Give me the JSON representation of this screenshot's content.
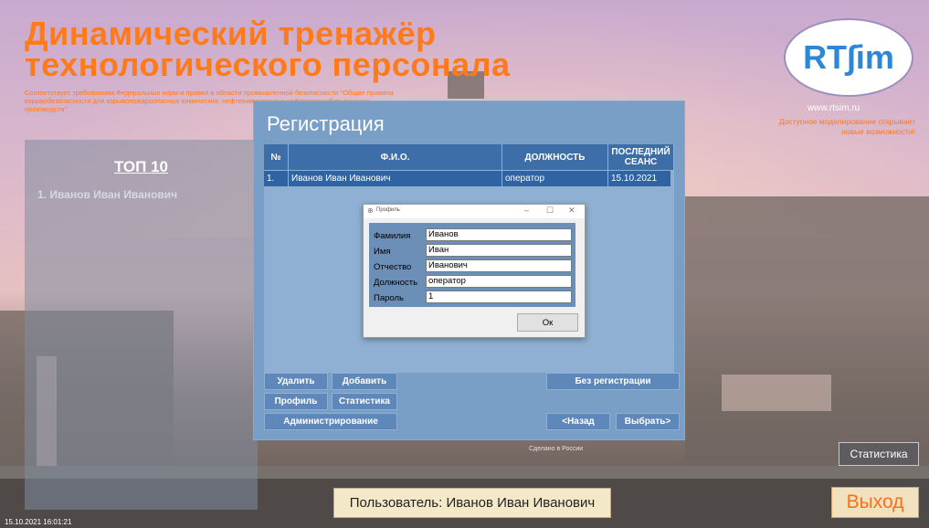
{
  "app": {
    "title_line1": "Динамический тренажёр",
    "title_line2": "технологического персонала",
    "subtitle": "Соответствует требованиям Федеральных норм и правил в области промышленной безопасности \"Общие правила взрывобезопасности для взрывопожароопасных химических, нефтехимических и нефтеперерабатывающих производств\"",
    "logo_text": "RT∫im",
    "logo_url": "www.rtsim.ru",
    "slogan": "Доступное моделирование открывает новые возможности!",
    "made_in": "Сделано в России"
  },
  "top10": {
    "title": "ТОП 10",
    "items": [
      "1. Иванов Иван Иванович"
    ]
  },
  "registration": {
    "title": "Регистрация",
    "columns": [
      "№",
      "Ф.И.О.",
      "ДОЛЖНОСТЬ",
      "ПОСЛЕДНИЙ СЕАНС"
    ],
    "rows": [
      {
        "num": "1.",
        "name": "Иванов Иван Иванович",
        "position": "оператор",
        "last_session": "15.10.2021"
      }
    ],
    "buttons": {
      "delete": "Удалить",
      "add": "Добавить",
      "profile": "Профиль",
      "statistics": "Статистика",
      "admin": "Администрирование",
      "no_registration": "Без регистрации",
      "back": "<Назад",
      "select": "Выбрать>"
    }
  },
  "profile_dialog": {
    "title": "Профиль",
    "controls": {
      "minimize": "–",
      "maximize": "☐",
      "close": "✕"
    },
    "fields": [
      {
        "label": "Фамилия",
        "value": "Иванов"
      },
      {
        "label": "Имя",
        "value": "Иван"
      },
      {
        "label": "Отчество",
        "value": "Иванович"
      },
      {
        "label": "Должность",
        "value": "оператор"
      },
      {
        "label": "Пароль",
        "value": "1"
      }
    ],
    "ok_label": "Ок"
  },
  "footer": {
    "user_label": "Пользователь: Иванов Иван Иванович",
    "statistics_label": "Статистика",
    "exit_label": "Выход",
    "datetime": "15.10.2021 16:01:21"
  },
  "colors": {
    "accent": "#ff7a1a",
    "panel": "#7a9fc7",
    "header": "#3d6ea8",
    "selected_row": "#2f63a2"
  }
}
